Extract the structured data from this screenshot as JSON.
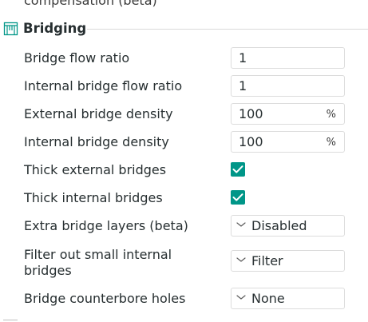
{
  "previous_section_tail": "compensation (beta)",
  "section": {
    "title": "Bridging",
    "icon": "bridge-icon"
  },
  "settings": {
    "bridge_flow_ratio": {
      "label": "Bridge flow ratio",
      "value": "1"
    },
    "internal_bridge_flow_ratio": {
      "label": "Internal bridge flow ratio",
      "value": "1"
    },
    "external_bridge_density": {
      "label": "External bridge density",
      "value": "100",
      "unit": "%"
    },
    "internal_bridge_density": {
      "label": "Internal bridge density",
      "value": "100",
      "unit": "%"
    },
    "thick_external_bridges": {
      "label": "Thick external bridges",
      "checked": true
    },
    "thick_internal_bridges": {
      "label": "Thick internal bridges",
      "checked": true
    },
    "extra_bridge_layers": {
      "label": "Extra bridge layers (beta)",
      "value": "Disabled"
    },
    "filter_small_internal_bridges": {
      "label_line1": "Filter out small internal",
      "label_line2": "bridges",
      "value": "Filter"
    },
    "bridge_counterbore_holes": {
      "label": "Bridge counterbore holes",
      "value": "None"
    }
  },
  "colors": {
    "accent": "#009688",
    "text": "#262e30",
    "border": "#dcdcdc"
  }
}
